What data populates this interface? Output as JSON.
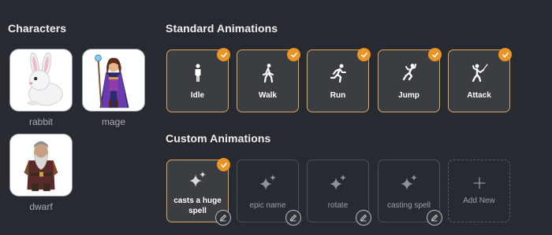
{
  "sections": {
    "characters": "Characters",
    "standard": "Standard Animations",
    "custom": "Custom Animations"
  },
  "characters": [
    {
      "label": "rabbit",
      "icon": "rabbit-portrait"
    },
    {
      "label": "mage",
      "icon": "mage-portrait"
    },
    {
      "label": "dwarf",
      "icon": "dwarf-portrait"
    }
  ],
  "standard_animations": [
    {
      "label": "Idle",
      "icon": "standing-person-icon",
      "selected": true
    },
    {
      "label": "Walk",
      "icon": "walking-person-icon",
      "selected": true
    },
    {
      "label": "Run",
      "icon": "running-person-icon",
      "selected": true
    },
    {
      "label": "Jump",
      "icon": "jumping-person-icon",
      "selected": true
    },
    {
      "label": "Attack",
      "icon": "fencing-person-icon",
      "selected": true
    }
  ],
  "custom_animations": [
    {
      "label": "casts a huge spell",
      "icon": "sparkles-icon",
      "selected": true
    },
    {
      "label": "epic name",
      "icon": "sparkles-icon",
      "selected": false
    },
    {
      "label": "rotate",
      "icon": "sparkles-icon",
      "selected": false
    },
    {
      "label": "casting spell",
      "icon": "sparkles-icon",
      "selected": false
    }
  ],
  "add_new": {
    "label": "Add New",
    "icon": "plus-icon"
  },
  "colors": {
    "background": "#272b31",
    "accent": "#eb9525",
    "selected_border": "#e0a45e",
    "tile_bg": "#3a3d42"
  }
}
